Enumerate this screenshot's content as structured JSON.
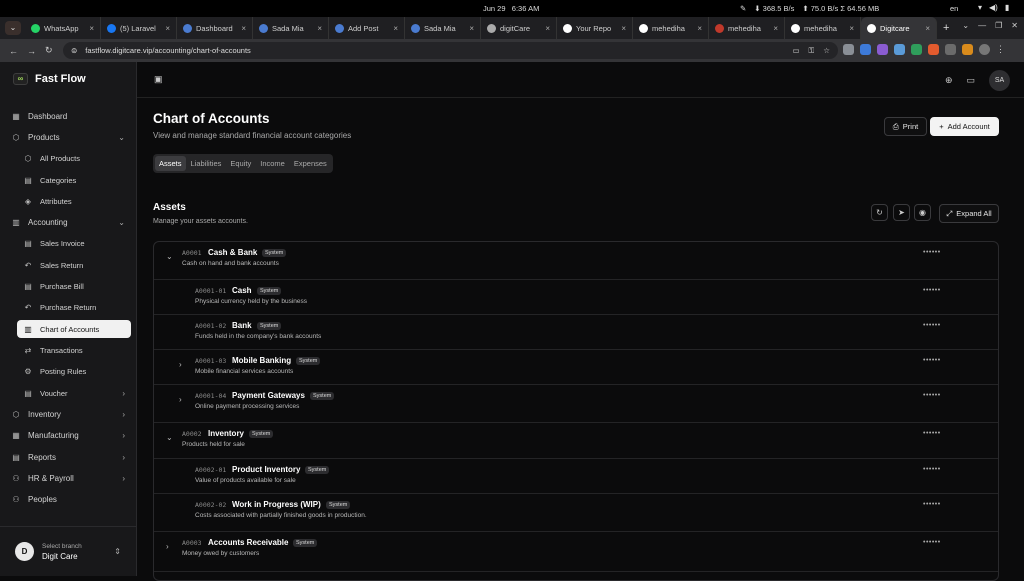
{
  "os": {
    "date": "Jun 29",
    "time": "6:36 AM",
    "net_down": "368.5 B/s",
    "net_up": "75.0 B/s",
    "mem": "64.56 MB",
    "lang": "en"
  },
  "browser": {
    "tabs": [
      {
        "label": "WhatsApp",
        "color": "#25d366"
      },
      {
        "label": "(5) Laravel",
        "color": "#1877f2"
      },
      {
        "label": "Dashboard",
        "color": "#4a7bd0"
      },
      {
        "label": "Sada Mia",
        "color": "#4a7bd0"
      },
      {
        "label": "Add Post",
        "color": "#4a7bd0"
      },
      {
        "label": "Sada Mia",
        "color": "#4a7bd0"
      },
      {
        "label": "digitCare",
        "color": "#aaaaaa"
      },
      {
        "label": "Your Repo",
        "color": "#ffffff"
      },
      {
        "label": "mehediha",
        "color": "#ffffff"
      },
      {
        "label": "mehediha",
        "color": "#c0392b"
      },
      {
        "label": "mehediha",
        "color": "#ffffff"
      },
      {
        "label": "Digitcare",
        "color": "#ffffff"
      }
    ],
    "url": "fastflow.digitcare.vip/accounting/chart-of-accounts"
  },
  "app": {
    "brand": "Fast Flow",
    "nav": {
      "dashboard": "Dashboard",
      "products": "Products",
      "all_products": "All Products",
      "categories": "Categories",
      "attributes": "Attributes",
      "accounting": "Accounting",
      "sales_invoice": "Sales Invoice",
      "sales_return": "Sales Return",
      "purchase_bill": "Purchase Bill",
      "purchase_return": "Purchase Return",
      "chart_of_accounts": "Chart of Accounts",
      "transactions": "Transactions",
      "posting_rules": "Posting Rules",
      "voucher": "Voucher",
      "inventory": "Inventory",
      "manufacturing": "Manufacturing",
      "reports": "Reports",
      "hr_payroll": "HR & Payroll",
      "peoples": "Peoples"
    },
    "branch": {
      "avatar": "D",
      "label": "Select branch",
      "name": "Digit Care"
    },
    "user_initials": "SA"
  },
  "page": {
    "title": "Chart of Accounts",
    "subtitle": "View and manage standard financial account categories",
    "print": "Print",
    "add": "Add Account",
    "tabs": [
      "Assets",
      "Liabilities",
      "Equity",
      "Income",
      "Expenses"
    ],
    "section_title": "Assets",
    "section_sub": "Manage your assets accounts.",
    "expand_all": "Expand All"
  },
  "accounts": [
    {
      "level": 0,
      "caret": "down",
      "code": "A0001",
      "name": "Cash & Bank",
      "badge": "System",
      "desc": "Cash on hand and bank accounts"
    },
    {
      "level": 1,
      "caret": "",
      "code": "A0001-01",
      "name": "Cash",
      "badge": "System",
      "desc": "Physical currency held by the business"
    },
    {
      "level": 1,
      "caret": "",
      "code": "A0001-02",
      "name": "Bank",
      "badge": "System",
      "desc": "Funds held in the company's bank accounts"
    },
    {
      "level": 1,
      "caret": "right",
      "code": "A0001-03",
      "name": "Mobile Banking",
      "badge": "System",
      "desc": "Mobile financial services accounts"
    },
    {
      "level": 1,
      "caret": "right",
      "code": "A0001-04",
      "name": "Payment Gateways",
      "badge": "System",
      "desc": "Online payment processing services"
    },
    {
      "level": 0,
      "caret": "down",
      "code": "A0002",
      "name": "Inventory",
      "badge": "System",
      "desc": "Products held for sale"
    },
    {
      "level": 1,
      "caret": "",
      "code": "A0002-01",
      "name": "Product Inventory",
      "badge": "System",
      "desc": "Value of products available for sale"
    },
    {
      "level": 1,
      "caret": "",
      "code": "A0002-02",
      "name": "Work in Progress (WIP)",
      "badge": "System",
      "desc": "Costs associated with partially finished goods in production."
    },
    {
      "level": 0,
      "caret": "right",
      "code": "A0003",
      "name": "Accounts Receivable",
      "badge": "System",
      "desc": "Money owed by customers"
    }
  ],
  "row_actions": "••••••"
}
